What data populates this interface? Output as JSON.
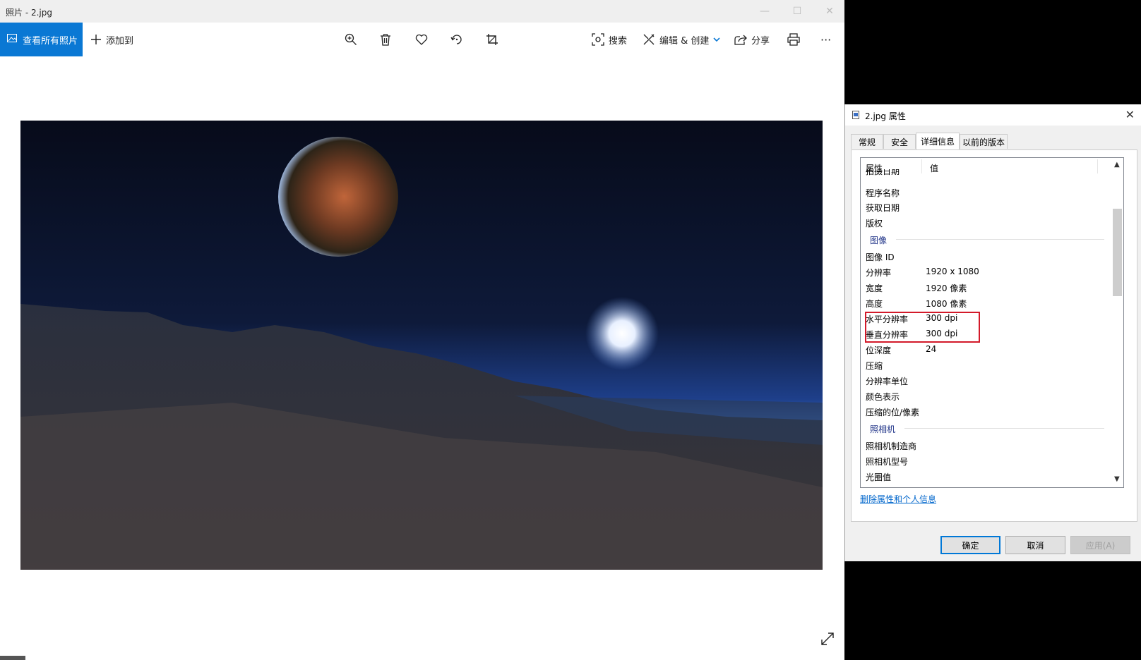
{
  "photos_app": {
    "title": "照片 - 2.jpg",
    "window_controls": {
      "minimize": "—",
      "maximize": "☐",
      "close": "✕"
    },
    "toolbar": {
      "view_all": "查看所有照片",
      "add_to": "添加到",
      "search": "搜索",
      "edit_create": "编辑 & 创建",
      "share": "分享",
      "more": "···"
    },
    "accent": "#0a78d4"
  },
  "dialog": {
    "title": "2.jpg 属性",
    "tabs": [
      "常规",
      "安全",
      "详细信息",
      "以前的版本"
    ],
    "active_tab": "详细信息",
    "list_header": {
      "name": "属性",
      "value": "值"
    },
    "rows_top": [
      {
        "name": "拍摄日期",
        "value": ""
      },
      {
        "name": "程序名称",
        "value": ""
      },
      {
        "name": "获取日期",
        "value": ""
      },
      {
        "name": "版权",
        "value": ""
      }
    ],
    "group_image": "图像",
    "rows_image": [
      {
        "name": "图像 ID",
        "value": ""
      },
      {
        "name": "分辨率",
        "value": "1920 x 1080"
      },
      {
        "name": "宽度",
        "value": "1920 像素"
      },
      {
        "name": "高度",
        "value": "1080 像素"
      },
      {
        "name": "水平分辨率",
        "value": "300 dpi"
      },
      {
        "name": "垂直分辨率",
        "value": "300 dpi"
      },
      {
        "name": "位深度",
        "value": "24"
      },
      {
        "name": "压缩",
        "value": ""
      },
      {
        "name": "分辨率单位",
        "value": ""
      },
      {
        "name": "颜色表示",
        "value": ""
      },
      {
        "name": "压缩的位/像素",
        "value": ""
      }
    ],
    "group_camera": "照相机",
    "rows_camera": [
      {
        "name": "照相机制造商",
        "value": ""
      },
      {
        "name": "照相机型号",
        "value": ""
      },
      {
        "name": "光圈值",
        "value": ""
      }
    ],
    "remove_link": "删除属性和个人信息",
    "buttons": {
      "ok": "确定",
      "cancel": "取消",
      "apply": "应用(A)"
    },
    "highlight_color": "#d31a2a"
  }
}
